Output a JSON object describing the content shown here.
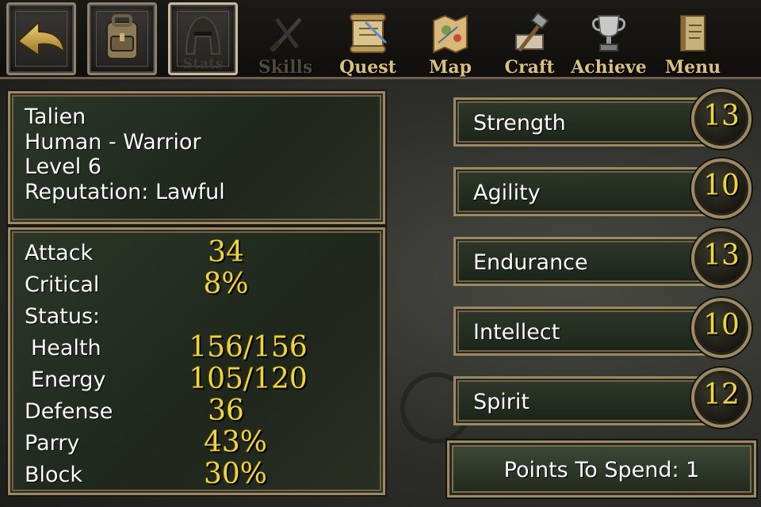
{
  "toolbar": {
    "buttons": [
      {
        "icon": "back-arrow-icon"
      },
      {
        "icon": "backpack-icon"
      },
      {
        "icon": "helmet-icon",
        "label": "Stats"
      }
    ],
    "tools": [
      {
        "label": "Skills",
        "icon": "crossed-swords-icon",
        "disabled": true
      },
      {
        "label": "Quest",
        "icon": "scroll-icon"
      },
      {
        "label": "Map",
        "icon": "map-icon"
      },
      {
        "label": "Craft",
        "icon": "hammer-icon"
      },
      {
        "label": "Achieve",
        "icon": "trophy-icon"
      },
      {
        "label": "Menu",
        "icon": "book-icon"
      }
    ]
  },
  "character": {
    "name": "Talien",
    "class": "Human - Warrior",
    "level": "Level 6",
    "reputation": "Reputation: Lawful"
  },
  "stats": {
    "attack": {
      "label": "Attack",
      "value": "34"
    },
    "critical": {
      "label": "Critical",
      "value": "8%"
    },
    "status": {
      "label": "Status:"
    },
    "health": {
      "label": "Health",
      "value": "156/156"
    },
    "energy": {
      "label": "Energy",
      "value": "105/120"
    },
    "defense": {
      "label": "Defense",
      "value": "36"
    },
    "parry": {
      "label": "Parry",
      "value": "43%"
    },
    "block": {
      "label": "Block",
      "value": "30%"
    }
  },
  "attributes": [
    {
      "label": "Strength",
      "value": "13"
    },
    {
      "label": "Agility",
      "value": "10"
    },
    {
      "label": "Endurance",
      "value": "13"
    },
    {
      "label": "Intellect",
      "value": "10"
    },
    {
      "label": "Spirit",
      "value": "12"
    }
  ],
  "points_to_spend": "Points To Spend: 1",
  "colors": {
    "value_gold": "#f0d630",
    "label_white": "#ffffff",
    "toolbar_label": "#d8c27a",
    "frame": "#9a8a66",
    "panel_green": "#2b3628"
  }
}
